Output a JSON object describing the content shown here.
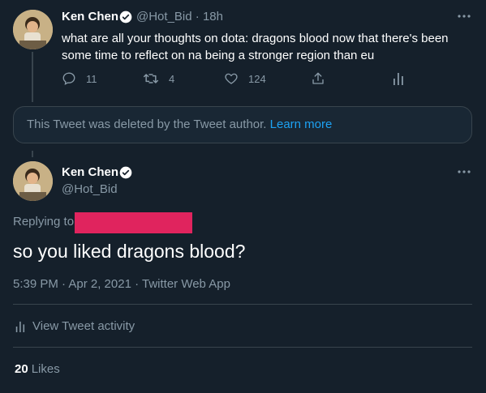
{
  "colors": {
    "background": "#15202b",
    "accent": "#1da1f2",
    "muted": "#8899a6",
    "border": "#38444d",
    "redaction": "#e0245e"
  },
  "parent_tweet": {
    "author_name": "Ken Chen",
    "handle": "@Hot_Bid",
    "separator": "·",
    "time": "18h",
    "text": "what are all your thoughts on dota: dragons blood now that there's been some time to reflect on na being a stronger region than eu",
    "actions": {
      "reply_icon": "reply-icon",
      "reply_count": "11",
      "retweet_icon": "retweet-icon",
      "retweet_count": "4",
      "like_icon": "heart-icon",
      "like_count": "124",
      "share_icon": "share-icon",
      "analytics_icon": "analytics-icon"
    }
  },
  "deleted_notice": {
    "text": "This Tweet was deleted by the Tweet author.",
    "link": "Learn more"
  },
  "main_tweet": {
    "author_name": "Ken Chen",
    "handle": "@Hot_Bid",
    "replying_to_label": "Replying to",
    "text": "so you liked dragons blood?",
    "timestamp": "5:39 PM · Apr 2, 2021 · Twitter Web App",
    "activity_label": "View Tweet activity",
    "likes_count": "20",
    "likes_label": "Likes"
  }
}
